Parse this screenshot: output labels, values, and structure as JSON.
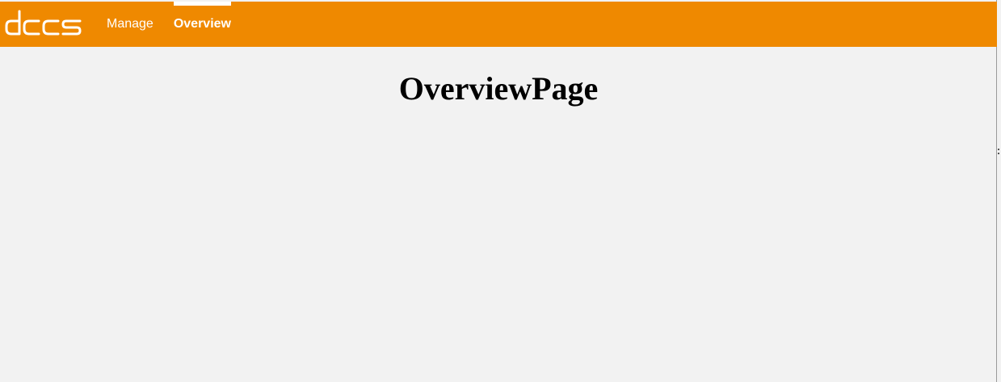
{
  "brand": {
    "logo_text": "dccs",
    "color": "#ef8900"
  },
  "nav": {
    "items": [
      {
        "label": "Manage",
        "active": false
      },
      {
        "label": "Overview",
        "active": true
      }
    ]
  },
  "main": {
    "title": "OverviewPage"
  }
}
